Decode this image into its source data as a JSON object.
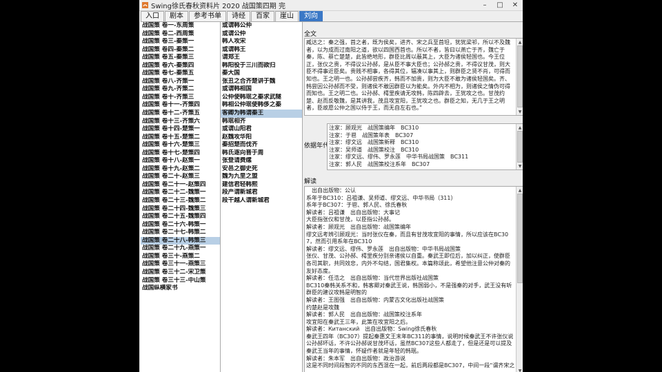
{
  "window": {
    "title": "Swing徐氏春秋资料片 2020 战国策四期 完"
  },
  "tabs": [
    "入口",
    "剧本",
    "参考书单",
    "诗经",
    "百家",
    "崖山",
    "刘向"
  ],
  "list1": [
    "战国策 卷一-东周策",
    "战国策 卷二-西周策",
    "战国策 卷三-秦策一",
    "战国策 卷四-秦策二",
    "战国策 卷五-秦策三",
    "战国策 卷六-秦策四",
    "战国策 卷七-秦策五",
    "战国策 卷八-齐策一",
    "战国策 卷九-齐策二",
    "战国策 卷十-齐策三",
    "战国策 卷十一-齐策四",
    "战国策 卷十二-齐策五",
    "战国策 卷十三-齐策六",
    "战国策 卷十四-楚策一",
    "战国策 卷十五-楚策二",
    "战国策 卷十六-楚策三",
    "战国策 卷十七-楚策四",
    "战国策 卷十八-赵策一",
    "战国策 卷十九-赵策二",
    "战国策 卷二十-赵策三",
    "战国策 卷二十一-赵策四",
    "战国策 卷二十二-魏策一",
    "战国策 卷二十三-魏策二",
    "战国策 卷二十四-魏策三",
    "战国策 卷二十五-魏策四",
    "战国策 卷二十六-韩策一",
    "战国策 卷二十七-韩策二",
    "战国策 卷二十八-韩策三",
    "战国策 卷二十九-燕策一",
    "战国策 卷三十-燕策二",
    "战国策 卷三十一-燕策三",
    "战国策 卷三十二-宋卫策",
    "战国策 卷三十三-中山策",
    "战国纵横家书"
  ],
  "list1_selected": 27,
  "list2": [
    "或谓韩公仲",
    "或谓公仲",
    "韩人攻宋",
    "或谓韩王",
    "谓郑王",
    "韩阳役于三川而欲归",
    "秦大国",
    "张丑之合齐楚讲于魏",
    "或谓韩相国",
    "公仲使韩珉之秦求武隧",
    "韩相公仲珉使韩侈之秦",
    "客卿为韩谓秦王",
    "韩珉相齐",
    "或谓山阳君",
    "赵魏攻华阳",
    "秦招楚而伐齐",
    "韩氏逐向晋于周",
    "张登请费缧",
    "安邑之御史死",
    "魏为九里之盟",
    "建信君轻韩熙",
    "段产谓新城君",
    "段干越人谓新城君"
  ],
  "list2_selected": 11,
  "labels": {
    "fulltext": "全文",
    "textual": "依据年代",
    "interpret": "解读"
  },
  "fulltext": "臧达之：秦之强，首之者，既为侯矣，进齐、宋之兵至首坦，犹犹梁祁，所以不及魏者，以为成而过南阳之道，欲以四国西首也。所以不者，皆曰以燕亡于齐，魏亡于秦，陈、蔡亡楚楚，此皆绝地形，群臣比周以蔽其上，大臣为诸侯轻国也。今王位正，张仪之贵，不得议公孙郝，是从臣不事大臣也；公孙郝之贵，不得议甘茂，则大臣不得事近臣矣。贵贱不相事，各得其位，辐凑以事其上，则群臣之贤不肖，可得而知也。王之明一也。公孙郝尝疾齐，韩而不加贵，则为大臣不敢为诸侯轻国矣。齐、韩尝因公孙郝而不受，则诸侯不敢因群臣以为能矣。外内不相为，则诸侯之情伪可得而知也。王之明二也。公孙郝、樗里疾请无攻韩，陈四辟去，王犹攻之也。甘茂约楚、赵而反敬魏，是其讲我，茂且攻宜阳，王犹攻之也。群臣之知，无几于王之明者，臣故愿公仲之国以侍于王，而无自左右也。”",
  "sources": [
    "注家：顾观光　战国策编年　BC310",
    "注家：于鬯　战国策年表　BC307",
    "注家：缪文远　战国策新释　BC310",
    "注家：吴师道　战国策校注　BC310",
    "注家：缪文远、缪伟、罗永莲　中华书局战国策　BC311",
    "注家：郭人民　战国策校注系年　BC307"
  ],
  "interpretation": [
    "　出自出版物：公认",
    "系年于BC310：吕祖谦、吴师道、缪文远、中华书局（311）",
    "系年于BC307：于鬯、郭人民、徐氏春秋",
    "解读者：吕祖谦　出自出版物：大事记",
    "大臣指张仪和甘茂，以臣指公孙郝。",
    "解读者：顾观光　出自出版物：战国策编年",
    "缪文远考辨引顾观光：当时张仪在秦，而且有甘茂攻宜阳的事情，所以应该在BC307，然而引用系年在BC310",
    "解读者：缪文远、缪伟、罗永莲　出自出版物：中华书局战国策",
    "张仪、甘茂、公孙郝、樗里疾分别亲诸侯以自重。秦武王即位后，加以纠正，使群臣各司其职，共同效忠，内外不勾结，国君集权。本篇称颂此，希望他注意公仲对秦的友好态度。",
    "解读者：任浩之　出自出版物：当代世界出版社战国策",
    "BC310秦韩关系不和，韩客卿对秦武王说，韩国弱小，不是强秦的对手，武王没有听群臣的建议攻韩是明智的",
    "解读者：王图强　出自出版物：内蒙古文化出版社战国策",
    "约楚赵是攻魏",
    "解读者：郭人民　出自出版物：战国策校注系年",
    "攻宜阳在秦武王三年，此策在攻宜阳之后。",
    "解读者：Китанский　出自出版物：Swing徐氏春秋",
    "秦武王四年（BC307）提起秦惠文王末年BC311的事情，说明时候秦武王不许张仪说公孙郝坏话，不许公孙郝说甘茂坏话，虽然BC307这些人都走了，但是还是可以提及秦武王当年的事情，怀疑作者就是年轻的韩珉。",
    "解读者：朱本军　出自出版物：政治游说",
    "这是不同时间段智的不同的东西混在一起，前后两段都是BC307，中间一段“谓齐宋之"
  ]
}
